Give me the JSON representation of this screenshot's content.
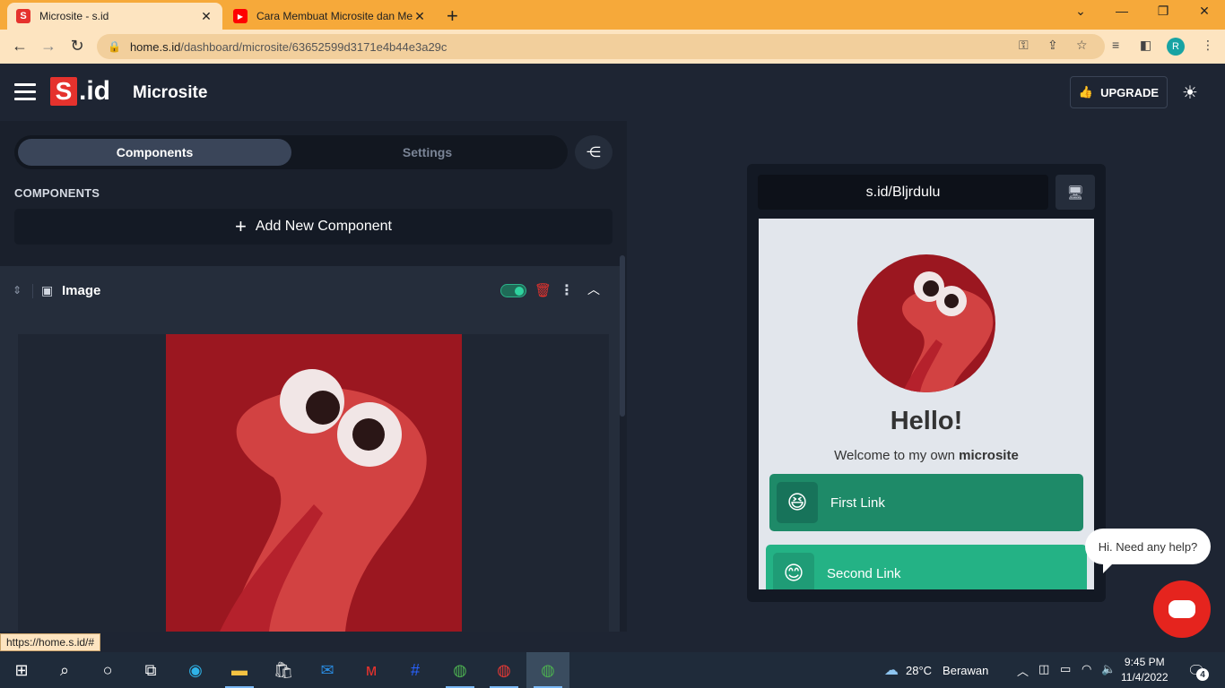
{
  "browser": {
    "tabs": [
      {
        "title": "Microsite - s.id",
        "active": true,
        "favicon_color": "#e5322d",
        "favicon_letter": "S"
      },
      {
        "title": "Cara Membuat Microsite dan Me",
        "active": false,
        "favicon_color": "#ff0000",
        "favicon_letter": "▶"
      }
    ],
    "new_tab_label": "+",
    "url_host": "home.s.id",
    "url_path": "/dashboard/microsite/63652599d3171e4b44e3a29c",
    "profile_initial": "R",
    "accent": "#f6a93a"
  },
  "app": {
    "logo_s": "S",
    "logo_id": ".id",
    "title": "Microsite",
    "upgrade_label": "UPGRADE",
    "brand_color": "#e5322d"
  },
  "editor": {
    "tabs": [
      "Components",
      "Settings"
    ],
    "active_tab": "Components",
    "section_label": "COMPONENTS",
    "add_component_label": "Add New Component",
    "component": {
      "title": "Image",
      "enabled": true
    }
  },
  "preview": {
    "url": "s.id/Bljrdulu",
    "hello": "Hello!",
    "welcome_prefix": "Welcome to my own ",
    "welcome_bold": "microsite",
    "links": [
      {
        "label": "First Link",
        "emoji": "😆",
        "color": "#1e8a68"
      },
      {
        "label": "Second Link",
        "emoji": "😊",
        "color": "#24b285"
      }
    ]
  },
  "chat": {
    "help_text": "Hi. Need any help?"
  },
  "status_bar": {
    "url": "https://home.s.id/#"
  },
  "taskbar": {
    "temperature": "28°C",
    "weather": "Berawan",
    "time": "9:45 PM",
    "date": "11/4/2022",
    "notifications": "4"
  }
}
